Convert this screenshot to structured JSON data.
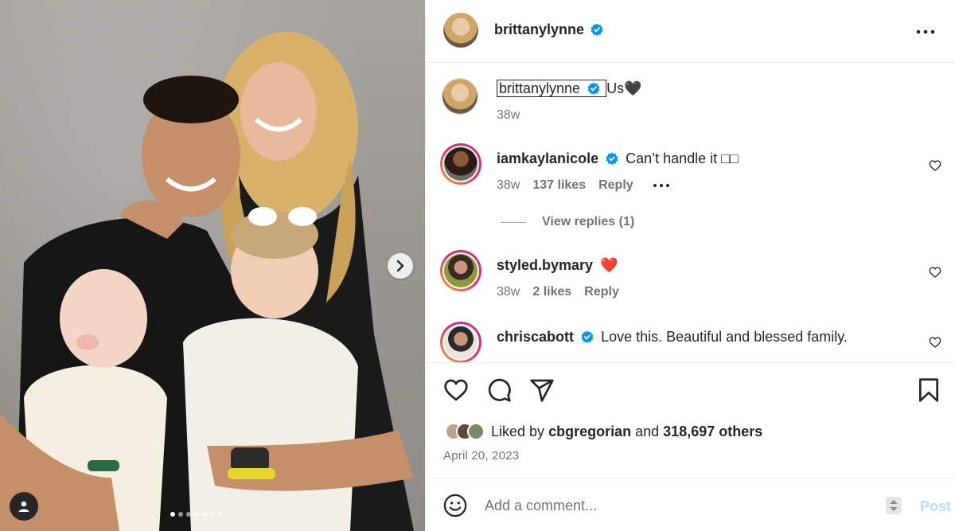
{
  "post": {
    "author": "brittanylynne",
    "verified": true,
    "photo_dots_count": 7,
    "photo_dots_active_index": 0
  },
  "caption": {
    "username": "brittanylynne",
    "text": "Us🖤",
    "time": "38w"
  },
  "comments": [
    {
      "username": "iamkaylanicole",
      "text": "Can’t handle it □□",
      "time": "38w",
      "likes": "137 likes",
      "reply": "Reply",
      "has_more": true,
      "verified": true
    },
    {
      "username": "styled.bymary",
      "text": "❤️",
      "time": "38w",
      "likes": "2 likes",
      "reply": "Reply",
      "has_more": false,
      "verified": false
    },
    {
      "username": "chriscabott",
      "text": "Love this. Beautiful and blessed family.",
      "verified": true
    }
  ],
  "view_replies": "View replies (1)",
  "liked_by": {
    "prefix": "Liked by",
    "user": "cbgregorian",
    "middle": "and",
    "count": "318,697 others"
  },
  "date": "April 20, 2023",
  "add_comment": {
    "placeholder": "Add a comment...",
    "post_label": "Post"
  },
  "colors": {
    "verified": "#0095f6",
    "heart_red": "#ed4956",
    "post_disabled": "#b2dffc",
    "muted": "#737373"
  }
}
